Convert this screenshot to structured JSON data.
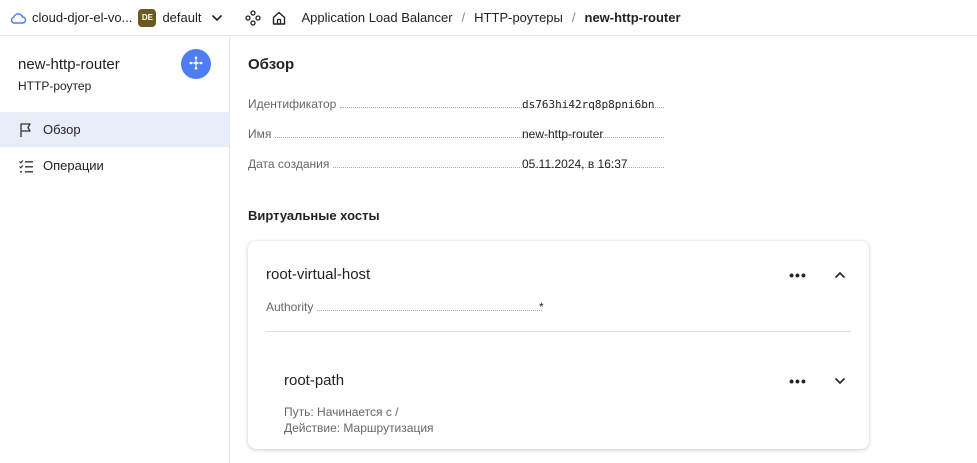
{
  "topbar": {
    "cloud_name": "cloud-djor-el-vo...",
    "folder_badge": "DE",
    "folder_name": "default",
    "breadcrumbs": [
      "Application Load Balancer",
      "HTTP-роутеры",
      "new-http-router"
    ]
  },
  "sidebar": {
    "title": "new-http-router",
    "subtitle": "HTTP-роутер",
    "items": [
      {
        "label": "Обзор",
        "icon": "flag-icon",
        "active": true
      },
      {
        "label": "Операции",
        "icon": "operations-list-icon",
        "active": false
      }
    ]
  },
  "main": {
    "title": "Обзор",
    "fields": [
      {
        "key": "Идентификатор",
        "value": "ds763hi42rq8p8pni6bn"
      },
      {
        "key": "Имя",
        "value": "new-http-router"
      },
      {
        "key": "Дата создания",
        "value": "05.11.2024, в 16:37"
      }
    ],
    "virtual_hosts_title": "Виртуальные хосты",
    "virtual_host": {
      "name": "root-virtual-host",
      "authority_key": "Authority",
      "authority_value": "*",
      "more_label": "•••",
      "route": {
        "name": "root-path",
        "path_line": "Путь: Начинается с /",
        "action_line": "Действие: Маршрутизация",
        "more_label": "•••"
      }
    }
  },
  "colors": {
    "accent": "#4d7df0",
    "active_nav_bg": "#e9edf8",
    "folder_badge_bg": "#6b5a1e"
  }
}
